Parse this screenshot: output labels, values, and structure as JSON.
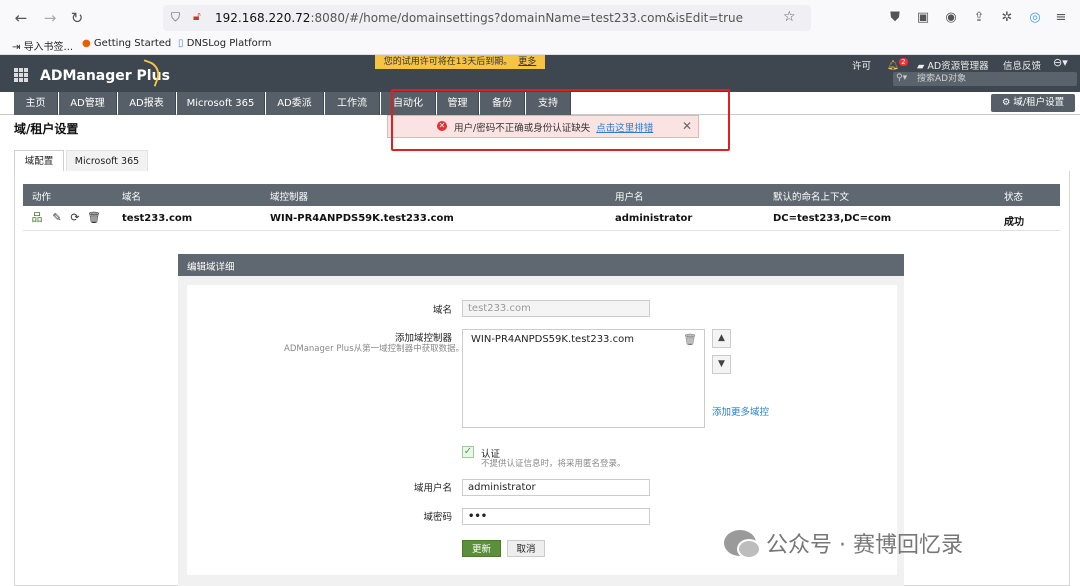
{
  "browser": {
    "url_prefix": "192.168.220.72",
    "url_rest": ":8080/#/home/domainsettings?domainName=test233.com&isEdit=true",
    "bookmarks": [
      "导入书签...",
      "Getting Started",
      "DNSLog Platform"
    ]
  },
  "header": {
    "trial_text": "您的试用许可将在13天后到期。",
    "trial_more": "更多",
    "logo": "ADManager Plus",
    "license_link": "许可",
    "notification_count": "2",
    "explorer_link": "AD资源管理器",
    "feedback_link": "信息反馈",
    "search_placeholder": "搜索AD对象"
  },
  "tabs": [
    "主页",
    "AD管理",
    "AD报表",
    "Microsoft 365",
    "AD委派",
    "工作流",
    "自动化",
    "管理",
    "备份",
    "支持"
  ],
  "domain_settings_button": "域/租户设置",
  "page_title": "域/租户设置",
  "error": {
    "message": "用户/密码不正确或身份认证缺失",
    "link": "点击这里排错"
  },
  "subtabs": [
    "域配置",
    "Microsoft 365"
  ],
  "table": {
    "headers": [
      "动作",
      "域名",
      "域控制器",
      "用户名",
      "默认的命名上下文",
      "状态"
    ],
    "row": {
      "domain": "test233.com",
      "dc": "WIN-PR4ANPDS59K.test233.com",
      "user": "administrator",
      "context": "DC=test233,DC=com",
      "status": "成功"
    }
  },
  "edit_form": {
    "title": "编辑域详细",
    "domain_label": "域名",
    "domain_value": "test233.com",
    "add_dc_label": "添加域控制器",
    "add_dc_hint": "ADManager Plus从第一域控制器中获取数据。",
    "dc_items": [
      "WIN-PR4ANPDS59K.test233.com"
    ],
    "add_more_dc": "添加更多域控",
    "auth_label": "认证",
    "auth_hint": "不提供认证信息时，将采用匿名登录。",
    "auth_checked": true,
    "username_label": "域用户名",
    "username_value": "administrator",
    "password_label": "域密码",
    "password_value": "•••",
    "update_button": "更新",
    "cancel_button": "取消"
  },
  "watermark": "公众号 · 赛博回忆录",
  "colors": {
    "header_bg": "#3e474f",
    "tab_bg": "#565f67",
    "trial_banner": "#f6c343",
    "error_bg": "#fbe3e3",
    "highlight_border": "#e02020",
    "update_button": "#5b8f3a"
  }
}
